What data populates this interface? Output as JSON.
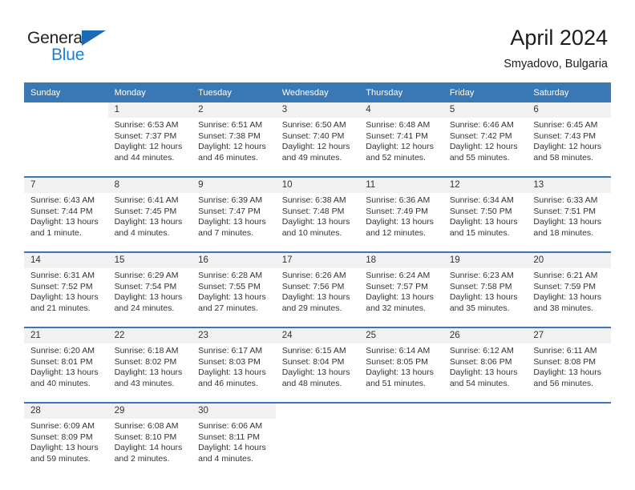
{
  "brand": {
    "name_part1": "General",
    "name_part2": "Blue",
    "triangle_icon": "triangle-icon"
  },
  "header": {
    "month_title": "April 2024",
    "location": "Smyadovo, Bulgaria"
  },
  "colors": {
    "header_blue": "#3a78b5",
    "logo_blue": "#1a7fd4",
    "daynum_background": "#f1f1f1",
    "text": "#333333"
  },
  "calendar": {
    "weekday_headers": [
      "Sunday",
      "Monday",
      "Tuesday",
      "Wednesday",
      "Thursday",
      "Friday",
      "Saturday"
    ],
    "weeks": [
      [
        {
          "day": "",
          "sunrise": "",
          "sunset": "",
          "daylight": "",
          "empty": true
        },
        {
          "day": "1",
          "sunrise": "Sunrise: 6:53 AM",
          "sunset": "Sunset: 7:37 PM",
          "daylight": "Daylight: 12 hours and 44 minutes."
        },
        {
          "day": "2",
          "sunrise": "Sunrise: 6:51 AM",
          "sunset": "Sunset: 7:38 PM",
          "daylight": "Daylight: 12 hours and 46 minutes."
        },
        {
          "day": "3",
          "sunrise": "Sunrise: 6:50 AM",
          "sunset": "Sunset: 7:40 PM",
          "daylight": "Daylight: 12 hours and 49 minutes."
        },
        {
          "day": "4",
          "sunrise": "Sunrise: 6:48 AM",
          "sunset": "Sunset: 7:41 PM",
          "daylight": "Daylight: 12 hours and 52 minutes."
        },
        {
          "day": "5",
          "sunrise": "Sunrise: 6:46 AM",
          "sunset": "Sunset: 7:42 PM",
          "daylight": "Daylight: 12 hours and 55 minutes."
        },
        {
          "day": "6",
          "sunrise": "Sunrise: 6:45 AM",
          "sunset": "Sunset: 7:43 PM",
          "daylight": "Daylight: 12 hours and 58 minutes."
        }
      ],
      [
        {
          "day": "7",
          "sunrise": "Sunrise: 6:43 AM",
          "sunset": "Sunset: 7:44 PM",
          "daylight": "Daylight: 13 hours and 1 minute."
        },
        {
          "day": "8",
          "sunrise": "Sunrise: 6:41 AM",
          "sunset": "Sunset: 7:45 PM",
          "daylight": "Daylight: 13 hours and 4 minutes."
        },
        {
          "day": "9",
          "sunrise": "Sunrise: 6:39 AM",
          "sunset": "Sunset: 7:47 PM",
          "daylight": "Daylight: 13 hours and 7 minutes."
        },
        {
          "day": "10",
          "sunrise": "Sunrise: 6:38 AM",
          "sunset": "Sunset: 7:48 PM",
          "daylight": "Daylight: 13 hours and 10 minutes."
        },
        {
          "day": "11",
          "sunrise": "Sunrise: 6:36 AM",
          "sunset": "Sunset: 7:49 PM",
          "daylight": "Daylight: 13 hours and 12 minutes."
        },
        {
          "day": "12",
          "sunrise": "Sunrise: 6:34 AM",
          "sunset": "Sunset: 7:50 PM",
          "daylight": "Daylight: 13 hours and 15 minutes."
        },
        {
          "day": "13",
          "sunrise": "Sunrise: 6:33 AM",
          "sunset": "Sunset: 7:51 PM",
          "daylight": "Daylight: 13 hours and 18 minutes."
        }
      ],
      [
        {
          "day": "14",
          "sunrise": "Sunrise: 6:31 AM",
          "sunset": "Sunset: 7:52 PM",
          "daylight": "Daylight: 13 hours and 21 minutes."
        },
        {
          "day": "15",
          "sunrise": "Sunrise: 6:29 AM",
          "sunset": "Sunset: 7:54 PM",
          "daylight": "Daylight: 13 hours and 24 minutes."
        },
        {
          "day": "16",
          "sunrise": "Sunrise: 6:28 AM",
          "sunset": "Sunset: 7:55 PM",
          "daylight": "Daylight: 13 hours and 27 minutes."
        },
        {
          "day": "17",
          "sunrise": "Sunrise: 6:26 AM",
          "sunset": "Sunset: 7:56 PM",
          "daylight": "Daylight: 13 hours and 29 minutes."
        },
        {
          "day": "18",
          "sunrise": "Sunrise: 6:24 AM",
          "sunset": "Sunset: 7:57 PM",
          "daylight": "Daylight: 13 hours and 32 minutes."
        },
        {
          "day": "19",
          "sunrise": "Sunrise: 6:23 AM",
          "sunset": "Sunset: 7:58 PM",
          "daylight": "Daylight: 13 hours and 35 minutes."
        },
        {
          "day": "20",
          "sunrise": "Sunrise: 6:21 AM",
          "sunset": "Sunset: 7:59 PM",
          "daylight": "Daylight: 13 hours and 38 minutes."
        }
      ],
      [
        {
          "day": "21",
          "sunrise": "Sunrise: 6:20 AM",
          "sunset": "Sunset: 8:01 PM",
          "daylight": "Daylight: 13 hours and 40 minutes."
        },
        {
          "day": "22",
          "sunrise": "Sunrise: 6:18 AM",
          "sunset": "Sunset: 8:02 PM",
          "daylight": "Daylight: 13 hours and 43 minutes."
        },
        {
          "day": "23",
          "sunrise": "Sunrise: 6:17 AM",
          "sunset": "Sunset: 8:03 PM",
          "daylight": "Daylight: 13 hours and 46 minutes."
        },
        {
          "day": "24",
          "sunrise": "Sunrise: 6:15 AM",
          "sunset": "Sunset: 8:04 PM",
          "daylight": "Daylight: 13 hours and 48 minutes."
        },
        {
          "day": "25",
          "sunrise": "Sunrise: 6:14 AM",
          "sunset": "Sunset: 8:05 PM",
          "daylight": "Daylight: 13 hours and 51 minutes."
        },
        {
          "day": "26",
          "sunrise": "Sunrise: 6:12 AM",
          "sunset": "Sunset: 8:06 PM",
          "daylight": "Daylight: 13 hours and 54 minutes."
        },
        {
          "day": "27",
          "sunrise": "Sunrise: 6:11 AM",
          "sunset": "Sunset: 8:08 PM",
          "daylight": "Daylight: 13 hours and 56 minutes."
        }
      ],
      [
        {
          "day": "28",
          "sunrise": "Sunrise: 6:09 AM",
          "sunset": "Sunset: 8:09 PM",
          "daylight": "Daylight: 13 hours and 59 minutes."
        },
        {
          "day": "29",
          "sunrise": "Sunrise: 6:08 AM",
          "sunset": "Sunset: 8:10 PM",
          "daylight": "Daylight: 14 hours and 2 minutes."
        },
        {
          "day": "30",
          "sunrise": "Sunrise: 6:06 AM",
          "sunset": "Sunset: 8:11 PM",
          "daylight": "Daylight: 14 hours and 4 minutes."
        },
        {
          "day": "",
          "sunrise": "",
          "sunset": "",
          "daylight": "",
          "empty": true
        },
        {
          "day": "",
          "sunrise": "",
          "sunset": "",
          "daylight": "",
          "empty": true
        },
        {
          "day": "",
          "sunrise": "",
          "sunset": "",
          "daylight": "",
          "empty": true
        },
        {
          "day": "",
          "sunrise": "",
          "sunset": "",
          "daylight": "",
          "empty": true
        }
      ]
    ]
  }
}
